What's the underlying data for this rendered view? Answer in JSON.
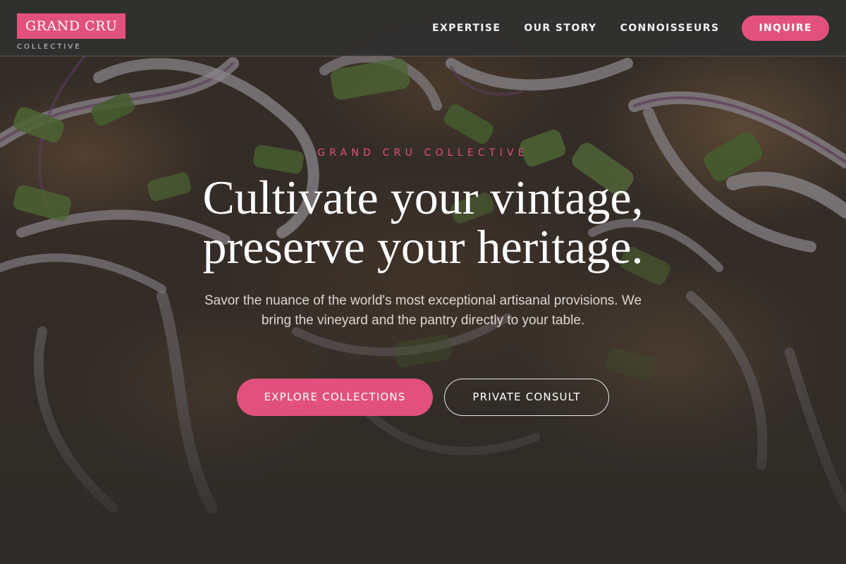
{
  "brand": {
    "name": "GRAND CRU",
    "tagline": "COLLECTIVE"
  },
  "nav": {
    "links": [
      "EXPERTISE",
      "OUR STORY",
      "CONNOISSEURS"
    ],
    "cta": "INQUIRE"
  },
  "hero": {
    "eyebrow": "GRAND CRU COLLECTIVE",
    "headline_line1": "Cultivate your vintage,",
    "headline_line2": "preserve your heritage.",
    "subtext": "Savor the nuance of the world's most exceptional artisanal provisions. We bring the vineyard and the pantry directly to your table.",
    "primary_button": "EXPLORE COLLECTIONS",
    "secondary_button": "PRIVATE CONSULT"
  },
  "colors": {
    "accent": "#e2517e",
    "nav_bg": "#303030",
    "page_bg": "#2c2b29"
  }
}
